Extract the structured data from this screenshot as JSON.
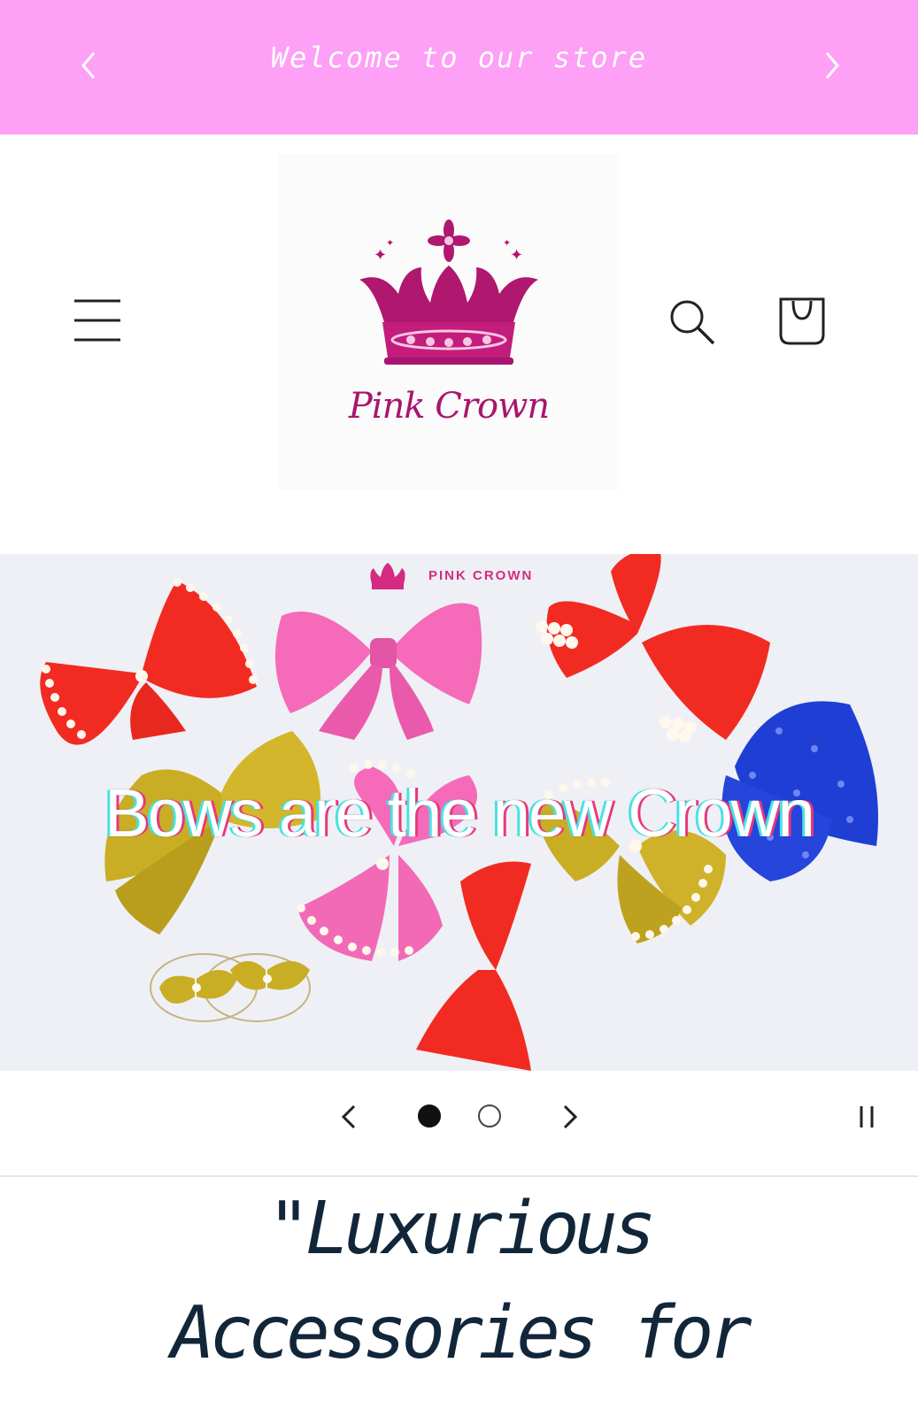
{
  "announcement": {
    "text": "Welcome to our store",
    "prev_icon": "chevron-left-icon",
    "next_icon": "chevron-right-icon"
  },
  "header": {
    "logo_text": "Pink Crown",
    "menu_icon": "hamburger-menu-icon",
    "search_icon": "search-icon",
    "cart_icon": "cart-icon"
  },
  "hero": {
    "brand_tag": "PINK CROWN",
    "title": "Bows are the new Crown",
    "slides_total": 2,
    "active_slide": 1
  },
  "slider_controls": {
    "prev_icon": "chevron-left-icon",
    "next_icon": "chevron-right-icon",
    "pause_icon": "pause-icon"
  },
  "intro": {
    "line1": "\"Luxurious",
    "line2": "Accessories for"
  },
  "colors": {
    "announcement_bg": "#fda0f6",
    "brand_pink": "#a8156e",
    "heading_navy": "#12263a"
  }
}
